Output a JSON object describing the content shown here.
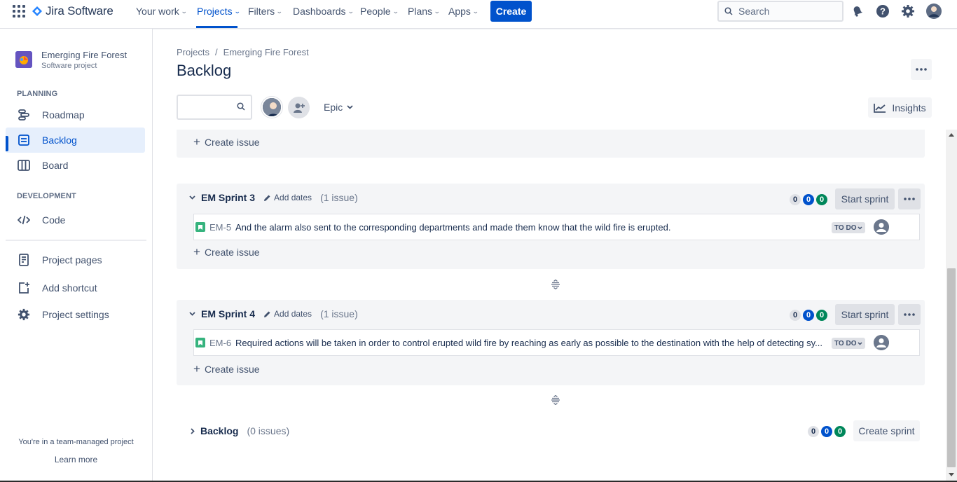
{
  "topnav": {
    "logo_text": "Jira Software",
    "items": [
      {
        "label": "Your work"
      },
      {
        "label": "Projects"
      },
      {
        "label": "Filters"
      },
      {
        "label": "Dashboards"
      },
      {
        "label": "People"
      },
      {
        "label": "Plans"
      },
      {
        "label": "Apps"
      }
    ],
    "create_label": "Create",
    "search_placeholder": "Search"
  },
  "sidebar": {
    "project_name": "Emerging Fire Forest",
    "project_type": "Software project",
    "planning_heading": "PLANNING",
    "development_heading": "DEVELOPMENT",
    "items": [
      {
        "label": "Roadmap",
        "icon": "roadmap-icon"
      },
      {
        "label": "Backlog",
        "icon": "backlog-icon"
      },
      {
        "label": "Board",
        "icon": "board-icon"
      },
      {
        "label": "Code",
        "icon": "code-icon"
      },
      {
        "label": "Project pages",
        "icon": "pages-icon"
      },
      {
        "label": "Add shortcut",
        "icon": "add-shortcut-icon"
      },
      {
        "label": "Project settings",
        "icon": "gear-icon"
      }
    ],
    "footer_text": "You're in a team-managed project",
    "learn_more": "Learn more"
  },
  "main": {
    "breadcrumb": {
      "root": "Projects",
      "separator": "/",
      "project": "Emerging Fire Forest"
    },
    "title": "Backlog",
    "epic_filter": "Epic",
    "insights_label": "Insights",
    "create_issue_label": "Create issue",
    "sprints": [
      {
        "name": "EM Sprint 3",
        "add_dates": "Add dates",
        "issue_count": "(1 issue)",
        "counts": [
          "0",
          "0",
          "0"
        ],
        "start_label": "Start sprint",
        "issues": [
          {
            "key": "EM-5",
            "summary": "And the alarm also sent to the corresponding departments and made them know that the wild fire is erupted.",
            "status": "TO DO"
          }
        ]
      },
      {
        "name": "EM Sprint 4",
        "add_dates": "Add dates",
        "issue_count": "(1 issue)",
        "counts": [
          "0",
          "0",
          "0"
        ],
        "start_label": "Start sprint",
        "issues": [
          {
            "key": "EM-6",
            "summary": "Required actions will be taken in order to control erupted wild fire by reaching as early as possible to the destination with the help of detecting sy...",
            "status": "TO DO"
          }
        ]
      }
    ],
    "backlog": {
      "name": "Backlog",
      "issue_count": "(0 issues)",
      "counts": [
        "0",
        "0",
        "0"
      ],
      "create_sprint_label": "Create sprint"
    }
  },
  "colors": {
    "brand": "#0052CC",
    "story": "#36B37E",
    "done": "#00875A"
  }
}
